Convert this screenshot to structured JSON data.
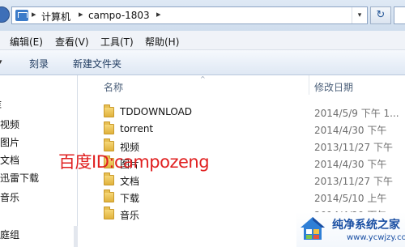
{
  "address": {
    "crumbs": [
      "计算机",
      "campo-1803"
    ],
    "refresh_glyph": "↻",
    "dropdown_glyph": "▾",
    "chevron_glyph": "▸"
  },
  "menu": {
    "items": [
      "编辑(E)",
      "查看(V)",
      "工具(T)",
      "帮助(H)"
    ]
  },
  "toolbar": {
    "items": [
      "刻录",
      "新建文件夹"
    ]
  },
  "nav": {
    "items": [
      "库",
      "视频",
      "图片",
      "文档",
      "迅雷下载",
      "音乐",
      "家庭组"
    ]
  },
  "columns": {
    "name": "名称",
    "date": "修改日期"
  },
  "files": [
    {
      "name": "TDDOWNLOAD",
      "date": "2014/5/9 下午 1..."
    },
    {
      "name": "torrent",
      "date": "2014/4/30 下午"
    },
    {
      "name": "视频",
      "date": "2013/11/27 下午"
    },
    {
      "name": "图片",
      "date": "2014/4/30 下午"
    },
    {
      "name": "文档",
      "date": "2013/11/27 下午"
    },
    {
      "name": "下载",
      "date": "2014/5/10 上午"
    },
    {
      "name": "音乐",
      "date": "2014/4/29 下午"
    }
  ],
  "watermark": "百度ID:campozeng",
  "logo": {
    "title": "纯净系统之家",
    "url": "www.ycwjzy.com"
  },
  "colors": {
    "watermark": "#e02020",
    "logo_blue": "#1a4fa3",
    "folder": "#e0b23c"
  }
}
